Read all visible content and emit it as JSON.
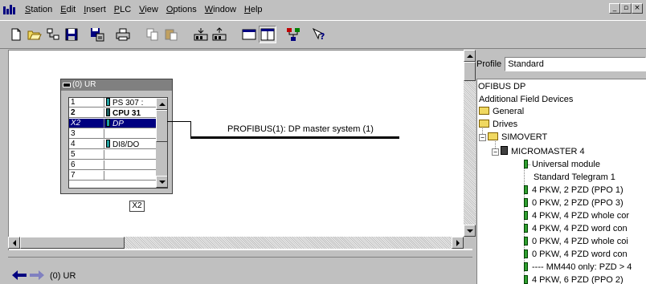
{
  "menubar": {
    "items": [
      {
        "label": "Station",
        "u": "S",
        "rest": "tation"
      },
      {
        "label": "Edit",
        "u": "E",
        "rest": "dit"
      },
      {
        "label": "Insert",
        "u": "I",
        "rest": "nsert"
      },
      {
        "label": "PLC",
        "u": "P",
        "rest": "LC"
      },
      {
        "label": "View",
        "u": "V",
        "rest": "iew"
      },
      {
        "label": "Options",
        "u": "O",
        "rest": "ptions"
      },
      {
        "label": "Window",
        "u": "W",
        "rest": "indow"
      },
      {
        "label": "Help",
        "u": "H",
        "rest": "elp"
      }
    ],
    "window_buttons": [
      "_",
      "▫",
      "×"
    ]
  },
  "toolbar": {
    "buttons": [
      "new-icon",
      "open-icon",
      "accessible-nodes-icon",
      "save-icon",
      "save-compile-icon",
      "print-icon",
      "copy-icon",
      "paste-icon",
      "download-icon",
      "upload-icon",
      "catalog-icon",
      "split-view-icon",
      "network-icon",
      "help-icon"
    ]
  },
  "rack": {
    "title": "(0) UR",
    "slots": [
      {
        "num": "1",
        "module": "PS 307 :",
        "icon": true
      },
      {
        "num": "2",
        "module": "CPU 31",
        "icon": true
      },
      {
        "num": "X2",
        "module": "DP",
        "icon": true
      },
      {
        "num": "3",
        "module": "",
        "icon": false
      },
      {
        "num": "4",
        "module": "DI8/DO",
        "icon": true
      },
      {
        "num": "5",
        "module": "",
        "icon": false
      },
      {
        "num": "6",
        "module": "",
        "icon": false
      },
      {
        "num": "7",
        "module": "",
        "icon": false
      }
    ],
    "interface_label": "X2"
  },
  "bus": {
    "label": "PROFIBUS(1): DP master system (1)"
  },
  "profile": {
    "label": "Profile",
    "selected": "Standard"
  },
  "tree": {
    "items": [
      {
        "label": "OFIBUS DP"
      },
      {
        "label": "Additional Field Devices"
      },
      {
        "label": "General"
      },
      {
        "label": "Drives"
      },
      {
        "label": "SIMOVERT"
      },
      {
        "label": "MICROMASTER 4"
      },
      {
        "label": "Universal module"
      },
      {
        "label": "Standard Telegram 1"
      },
      {
        "label": "4 PKW,  2 PZD  (PPO 1)"
      },
      {
        "label": "0 PKW,  2 PZD  (PPO 3)"
      },
      {
        "label": "4 PKW,  4 PZD whole cor"
      },
      {
        "label": "4 PKW,  4 PZD word con"
      },
      {
        "label": "0 PKW,  4 PZD whole coi"
      },
      {
        "label": "0 PKW,  4 PZD word con"
      },
      {
        "label": "---- MM440 only: PZD > 4"
      },
      {
        "label": "4 PKW,  6 PZD  (PPO 2)"
      }
    ]
  },
  "bottom": {
    "label": "(0)   UR"
  },
  "colors": {
    "selection": "#000080",
    "face": "#c0c0c0",
    "canvas": "#ffffff"
  }
}
